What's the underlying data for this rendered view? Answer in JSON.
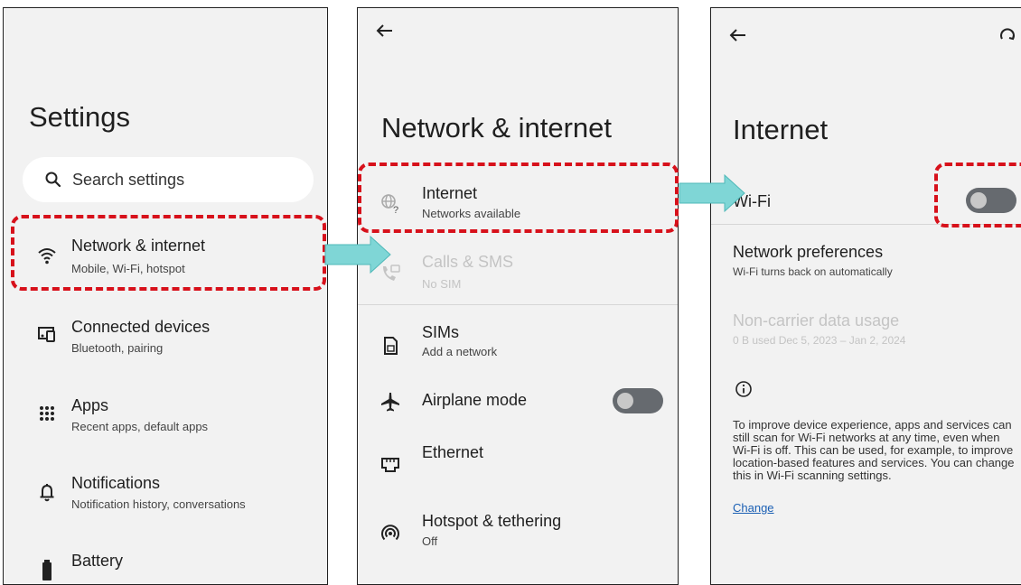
{
  "screen1": {
    "title": "Settings",
    "search_placeholder": "Search settings",
    "items": [
      {
        "title": "Network & internet",
        "subtitle": "Mobile, Wi-Fi, hotspot",
        "icon": "wifi-icon"
      },
      {
        "title": "Connected devices",
        "subtitle": "Bluetooth, pairing",
        "icon": "connected-devices-icon"
      },
      {
        "title": "Apps",
        "subtitle": "Recent apps, default apps",
        "icon": "apps-grid-icon"
      },
      {
        "title": "Notifications",
        "subtitle": "Notification history, conversations",
        "icon": "bell-icon"
      },
      {
        "title": "Battery",
        "subtitle": "",
        "icon": "battery-icon"
      }
    ]
  },
  "screen2": {
    "title": "Network & internet",
    "items": [
      {
        "title": "Internet",
        "subtitle": "Networks available",
        "icon": "globe-question-icon"
      },
      {
        "title": "Calls & SMS",
        "subtitle": "No SIM",
        "icon": "calls-sms-icon",
        "disabled": true
      },
      {
        "title": "SIMs",
        "subtitle": "Add a network",
        "icon": "sim-card-icon"
      },
      {
        "title": "Airplane mode",
        "subtitle": "",
        "icon": "airplane-icon",
        "toggle": "off"
      },
      {
        "title": "Ethernet",
        "subtitle": "",
        "icon": "ethernet-icon"
      },
      {
        "title": "Hotspot & tethering",
        "subtitle": "Off",
        "icon": "hotspot-icon"
      }
    ]
  },
  "screen3": {
    "title": "Internet",
    "wifi_label": "Wi-Fi",
    "wifi_toggle": "off",
    "items": [
      {
        "title": "Network preferences",
        "subtitle": "Wi-Fi turns back on automatically"
      },
      {
        "title": "Non-carrier data usage",
        "subtitle": "0 B used Dec 5, 2023 – Jan 2, 2024",
        "disabled": true
      }
    ],
    "info_text": "To improve device experience, apps and services can still scan for Wi-Fi networks at any time, even when Wi-Fi is off. This can be used, for example, to improve location-based features and services. You can change this in Wi-Fi scanning settings.",
    "change_link": "Change"
  },
  "colors": {
    "highlight": "#d7111b",
    "arrow": "#7fd6d6",
    "toggle_off_track": "#666a6f",
    "background": "#f2f2f2"
  }
}
